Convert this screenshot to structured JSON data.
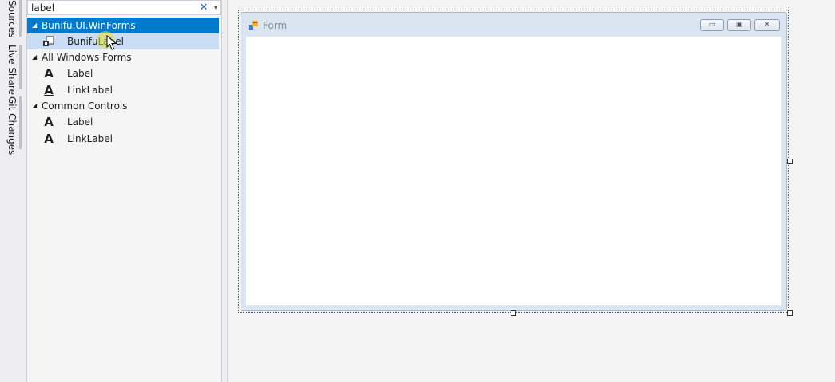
{
  "side_tabs": [
    "Sources",
    "Live Share",
    "Git Changes"
  ],
  "toolbox": {
    "search_value": "label",
    "search_clear_glyph": "✕",
    "search_dropdown_glyph": "▾",
    "groups": [
      {
        "name": "Bunifu.UI.WinForms",
        "items": [
          {
            "label": "BunifuLabel",
            "icon": "bunifu-label-icon"
          }
        ]
      },
      {
        "name": "All Windows Forms",
        "items": [
          {
            "label": "Label",
            "icon": "label-icon"
          },
          {
            "label": "LinkLabel",
            "icon": "link-label-icon"
          }
        ]
      },
      {
        "name": "Common Controls",
        "items": [
          {
            "label": "Label",
            "icon": "label-icon"
          },
          {
            "label": "LinkLabel",
            "icon": "link-label-icon"
          }
        ]
      }
    ],
    "expander_glyph": "◢",
    "label_icon_glyph": "A"
  },
  "designer": {
    "form_title": "Form",
    "caption_buttons": {
      "minimize": "▭",
      "maximize": "▣",
      "close": "✕"
    }
  },
  "colors": {
    "selected_row": "#007acc",
    "hover_row": "#c9def5",
    "accent": "#007acc"
  }
}
